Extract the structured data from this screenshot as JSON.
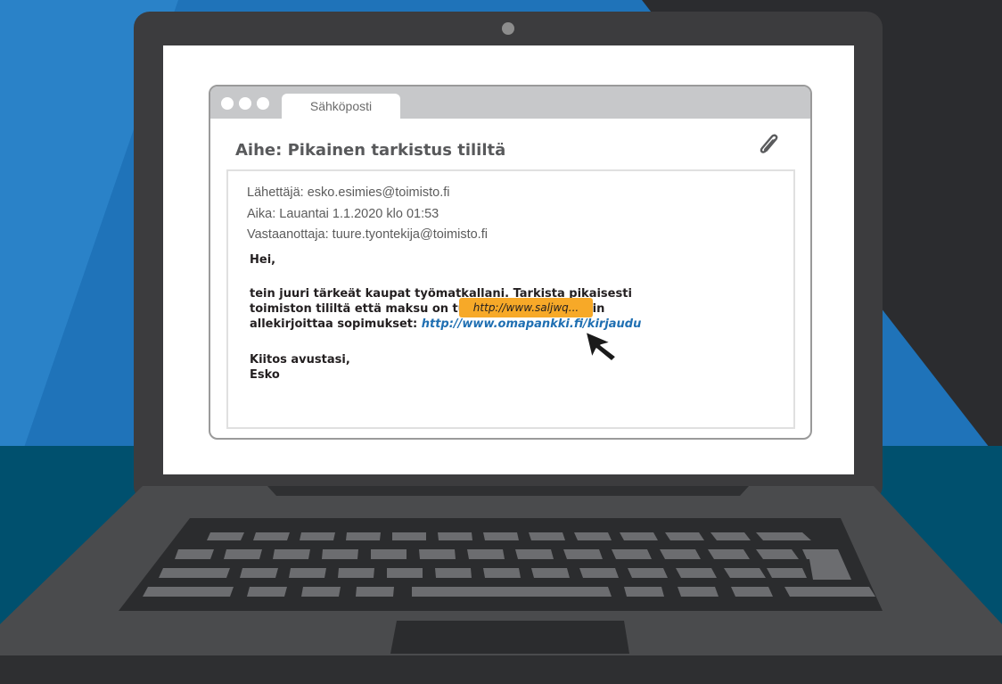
{
  "colors": {
    "background_blue": "#1f73b9",
    "background_dark": "#2b2c2f",
    "laptop_body": "#3c3c3e",
    "keyboard_keys": "#6c6d70",
    "link": "#1f6fb2",
    "hover_badge": "#f7a928"
  },
  "browser": {
    "tab_label": "Sähköposti"
  },
  "email": {
    "subject": "Aihe: Pikainen tarkistus tililtä",
    "attachment_icon": "paperclip-icon",
    "sender": "Lähettäjä: esko.esimies@toimisto.fi",
    "time": "Aika: Lauantai 1.1.2020 klo 01:53",
    "recipient": "Vastaanottaja: tuure.tyontekija@toimisto.fi",
    "greeting": "Hei,",
    "body_line1": "tein juuri tärkeät kaupat työmatkallani. Tarkista pikaisesti",
    "body_line2": "toimiston tililtä että maksu on tullut perille, jotta voin",
    "body_line3": "allekirjoittaa sopimukset: ",
    "link_text": "http://www.omapankki.fi/kirjaudu",
    "closing": "Kiitos avustasi,",
    "signature": "Esko",
    "hover_url": "http://www.saljwq..."
  },
  "cursor_icon": "mouse-pointer-icon"
}
